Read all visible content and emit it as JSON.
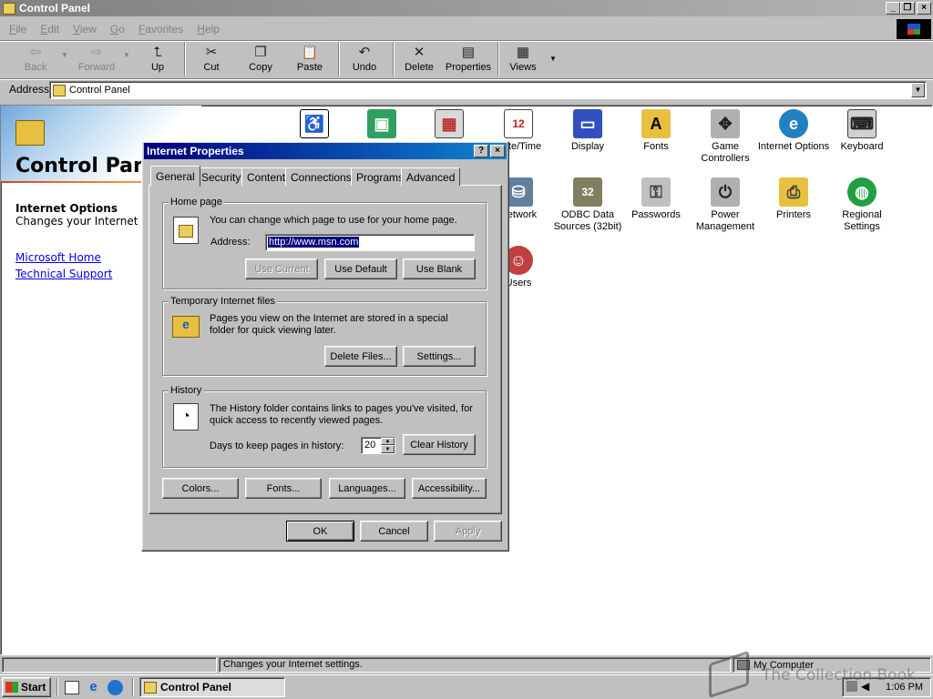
{
  "window": {
    "title": "Control Panel",
    "min_icon": "minimize-icon",
    "max_icon": "restore-icon",
    "close_icon": "close-icon"
  },
  "menu": [
    "File",
    "Edit",
    "View",
    "Go",
    "Favorites",
    "Help"
  ],
  "toolbar": {
    "back": "Back",
    "forward": "Forward",
    "up": "Up",
    "cut": "Cut",
    "copy": "Copy",
    "paste": "Paste",
    "undo": "Undo",
    "delete": "Delete",
    "properties": "Properties",
    "views": "Views"
  },
  "address": {
    "label": "Address",
    "value": "Control Panel"
  },
  "left_pane": {
    "title": "Control Panel",
    "section_title": "Internet Options",
    "section_desc": "Changes your Internet settings.",
    "links": [
      "Microsoft Home",
      "Technical Support"
    ]
  },
  "icons": {
    "datetime": "Date/Time",
    "display": "Display",
    "fonts": "Fonts",
    "game": "Game Controllers",
    "internet": "Internet Options",
    "keyboard": "Keyboard",
    "network": "Network",
    "odbc": "ODBC Data Sources (32bit)",
    "passwords": "Passwords",
    "power": "Power Management",
    "printers": "Printers",
    "regional": "Regional Settings",
    "users": "Users"
  },
  "dialog": {
    "title": "Internet Properties",
    "help_btn": "?",
    "close_btn": "×",
    "tabs": [
      "General",
      "Security",
      "Content",
      "Connections",
      "Programs",
      "Advanced"
    ],
    "homepage": {
      "title": "Home page",
      "desc": "You can change which page to use for your home page.",
      "address_label": "Address:",
      "address_value": "http://www.msn.com",
      "use_current": "Use Current",
      "use_default": "Use Default",
      "use_blank": "Use Blank"
    },
    "temp": {
      "title": "Temporary Internet files",
      "desc": "Pages you view on the Internet are stored in a special folder for quick viewing later.",
      "delete_files": "Delete Files...",
      "settings": "Settings..."
    },
    "history": {
      "title": "History",
      "desc": "The History folder contains links to pages you've visited, for quick access to recently viewed pages.",
      "days_label": "Days to keep pages in history:",
      "days_value": "20",
      "clear": "Clear History"
    },
    "bottom": {
      "colors": "Colors...",
      "fonts": "Fonts...",
      "languages": "Languages...",
      "accessibility": "Accessibility..."
    },
    "ok": "OK",
    "cancel": "Cancel",
    "apply": "Apply"
  },
  "status": {
    "text": "Changes your Internet settings.",
    "zone": "My Computer"
  },
  "taskbar": {
    "start": "Start",
    "task": "Control Panel",
    "clock": "1:06 PM"
  },
  "watermark": "The Collection Book",
  "colors": {
    "title_active": "#000080",
    "title_inactive": "#808080",
    "desktop": "#c0c0c0",
    "link": "#0000ee"
  }
}
